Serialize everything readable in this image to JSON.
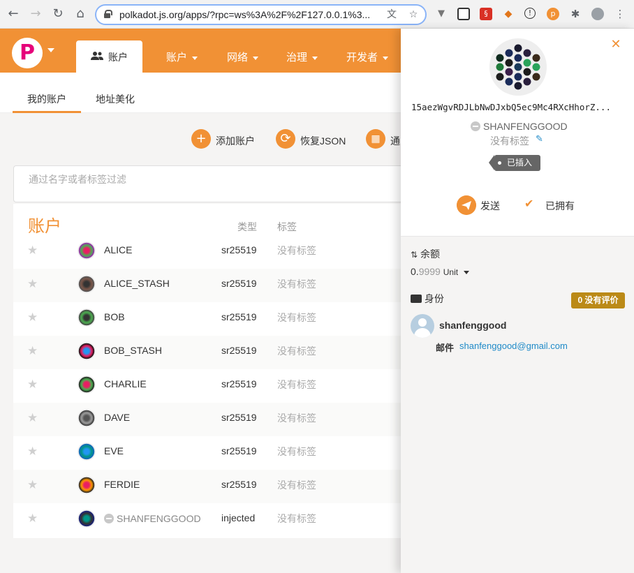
{
  "browser": {
    "url": "polkadot.js.org/apps/?rpc=ws%3A%2F%2F127.0.0.1%3..."
  },
  "header": {
    "active_tab": "账户",
    "nav": [
      "账户",
      "网络",
      "治理",
      "开发者"
    ]
  },
  "subtabs": [
    "我的账户",
    "地址美化"
  ],
  "actions": {
    "add": "添加账户",
    "restore": "恢复JSON",
    "qr": "通"
  },
  "filter": {
    "placeholder": "通过名字或者标签过滤"
  },
  "table": {
    "title": "账户",
    "col_type": "类型",
    "col_tags": "标签",
    "rows": [
      {
        "name": "ALICE",
        "type": "sr25519",
        "tag": "没有标签"
      },
      {
        "name": "ALICE_STASH",
        "type": "sr25519",
        "tag": "没有标签"
      },
      {
        "name": "BOB",
        "type": "sr25519",
        "tag": "没有标签"
      },
      {
        "name": "BOB_STASH",
        "type": "sr25519",
        "tag": "没有标签"
      },
      {
        "name": "CHARLIE",
        "type": "sr25519",
        "tag": "没有标签"
      },
      {
        "name": "DAVE",
        "type": "sr25519",
        "tag": "没有标签"
      },
      {
        "name": "EVE",
        "type": "sr25519",
        "tag": "没有标签"
      },
      {
        "name": "FERDIE",
        "type": "sr25519",
        "tag": "没有标签"
      },
      {
        "name": "SHANFENGGOOD",
        "type": "injected",
        "tag": "没有标签"
      }
    ]
  },
  "panel": {
    "address": "15aezWgvRDJLbNwDJxbQ5ec9Mc4RXcHhorZ...",
    "name": "SHANFENGGOOD",
    "no_tag": "没有标签",
    "injected_badge": "已插入",
    "send": "发送",
    "owned": "已拥有",
    "balance_label": "余额",
    "balance_int": "0.",
    "balance_dec": "9999",
    "balance_unit": "Unit",
    "identity_label": "身份",
    "judgement": "0 没有评价",
    "identity_name": "shanfenggood",
    "email_label": "邮件",
    "email": "shanfenggood@gmail.com"
  },
  "colors": {
    "accent": "#f19135",
    "link": "#1f8ac8",
    "judgement": "#bb8a17"
  }
}
